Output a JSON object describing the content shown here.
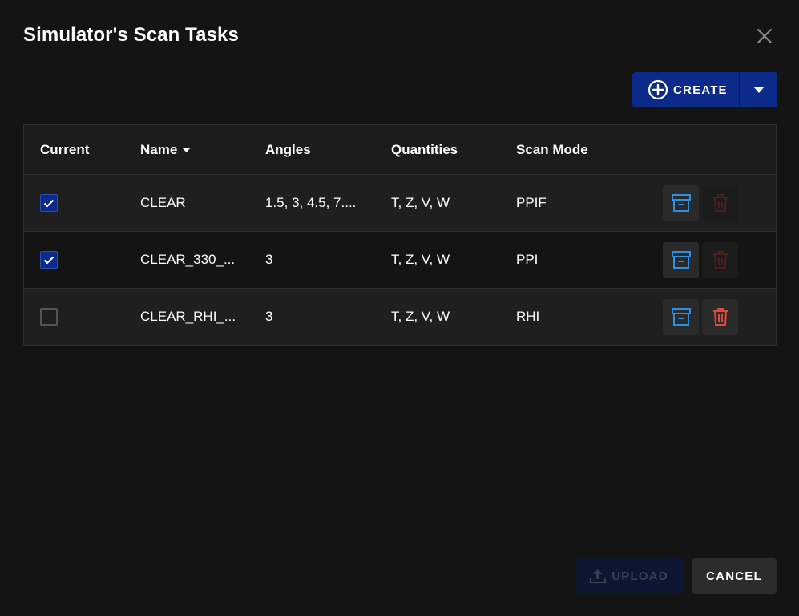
{
  "dialog": {
    "title": "Simulator's Scan Tasks"
  },
  "toolbar": {
    "create_label": "CREATE"
  },
  "table": {
    "columns": {
      "current": "Current",
      "name": "Name",
      "angles": "Angles",
      "quantities": "Quantities",
      "scan_mode": "Scan Mode"
    },
    "rows": [
      {
        "current": true,
        "name": "CLEAR",
        "angles": "1.5, 3, 4.5, 7....",
        "quantities": "T, Z, V, W",
        "scan_mode": "PPIF",
        "delete_enabled": false
      },
      {
        "current": true,
        "name": "CLEAR_330_...",
        "angles": "3",
        "quantities": "T, Z, V, W",
        "scan_mode": "PPI",
        "delete_enabled": false
      },
      {
        "current": false,
        "name": "CLEAR_RHI_...",
        "angles": "3",
        "quantities": "T, Z, V, W",
        "scan_mode": "RHI",
        "delete_enabled": true
      }
    ]
  },
  "footer": {
    "upload_label": "UPLOAD",
    "cancel_label": "CANCEL"
  },
  "colors": {
    "accent": "#0b2a8a",
    "archive_icon": "#2f8fe0",
    "delete_icon": "#e0483c",
    "delete_icon_disabled": "#4a201d"
  },
  "icons": {
    "close": "close-icon",
    "create": "plus-circle-icon",
    "dropdown": "caret-down-icon",
    "sort": "sort-desc-icon",
    "check": "check-icon",
    "archive": "archive-icon",
    "delete": "trash-icon",
    "upload": "upload-icon"
  }
}
